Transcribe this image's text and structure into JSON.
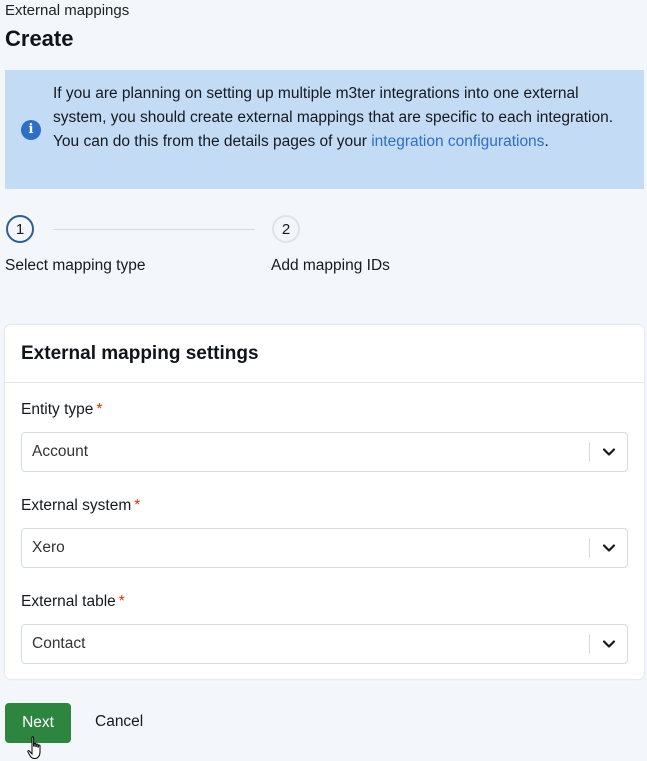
{
  "breadcrumb": "External mappings",
  "page_title": "Create",
  "info": {
    "icon": "info-icon",
    "text_before": "If you are planning on setting up multiple m3ter integrations into one external system, you should create external mappings that are specific to each integration. You can do this from the details pages of your ",
    "link_text": "integration configurations",
    "text_after": ".",
    "bg_color": "#c3dbf5",
    "link_color": "#2e6fc4"
  },
  "stepper": {
    "steps": [
      {
        "number": "1",
        "label": "Select mapping type",
        "active": true
      },
      {
        "number": "2",
        "label": "Add mapping IDs",
        "active": false
      }
    ]
  },
  "card": {
    "title": "External mapping settings",
    "fields": [
      {
        "label": "Entity type",
        "required_marker": "*",
        "value": "Account"
      },
      {
        "label": "External system",
        "required_marker": "*",
        "value": "Xero"
      },
      {
        "label": "External table",
        "required_marker": "*",
        "value": "Contact"
      }
    ]
  },
  "actions": {
    "next_label": "Next",
    "cancel_label": "Cancel",
    "primary_color": "#2e8540"
  }
}
